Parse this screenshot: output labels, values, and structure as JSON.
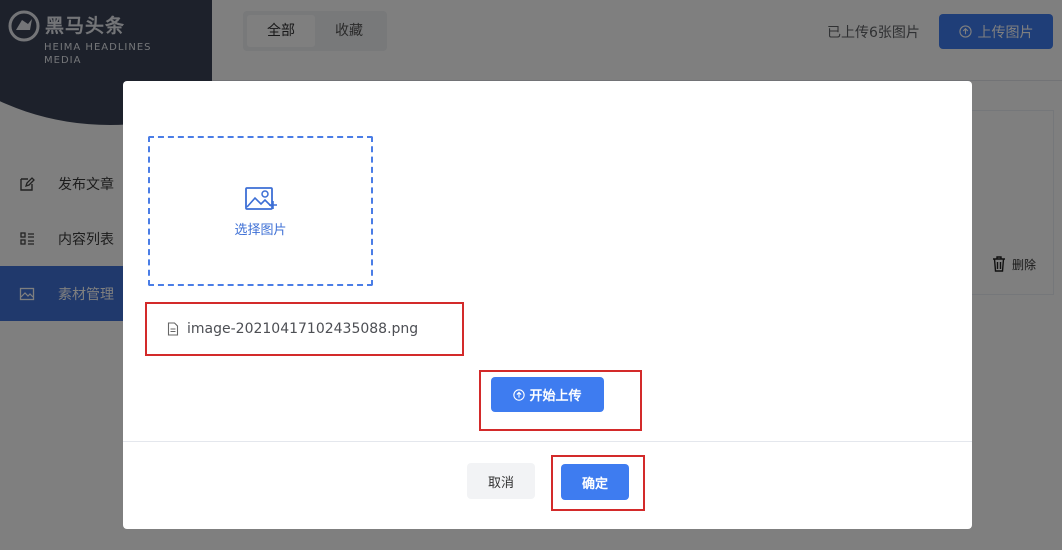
{
  "sidebar": {
    "logo_title": "黑马头条",
    "logo_subtitle": "HEIMA HEADLINES MEDIA",
    "items": [
      {
        "label": "发布文章",
        "icon": "edit-icon"
      },
      {
        "label": "内容列表",
        "icon": "list-icon"
      },
      {
        "label": "素材管理",
        "icon": "image-icon",
        "active": true
      }
    ]
  },
  "main": {
    "tabs": [
      {
        "label": "全部",
        "active": true
      },
      {
        "label": "收藏"
      }
    ],
    "upload_count": "已上传6张图片",
    "upload_button": "上传图片",
    "delete_label": "删除"
  },
  "dialog": {
    "dropzone_label": "选择图片",
    "file_name": "image-20210417102435088.png",
    "start_upload": "开始上传",
    "cancel": "取消",
    "confirm": "确定"
  },
  "colors": {
    "primary": "#3e7cf0",
    "sidebar_dark": "#3a4356",
    "highlight_border": "#d32a2a"
  }
}
